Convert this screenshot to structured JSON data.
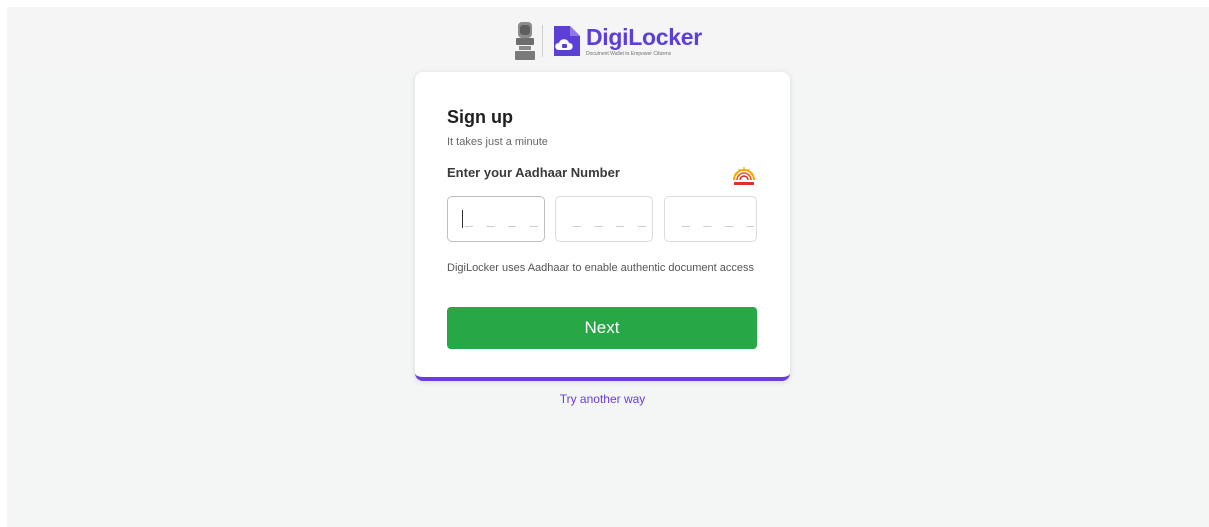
{
  "brand": {
    "name": "DigiLocker",
    "tagline": "Document Wallet to Empower Citizens",
    "accent_color": "#5b3fd6"
  },
  "form": {
    "title": "Sign up",
    "subtitle": "It takes just a minute",
    "aadhaar_label": "Enter your Aadhaar Number",
    "aadhaar_logo_text": "AADHAAR",
    "digit_fields": [
      {
        "value": "",
        "placeholder": "_ _ _ _"
      },
      {
        "value": "",
        "placeholder": "_ _ _ _"
      },
      {
        "value": "",
        "placeholder": "_ _ _ _"
      }
    ],
    "info_text": "DigiLocker uses Aadhaar to enable authentic document access",
    "next_label": "Next",
    "next_color": "#27a745",
    "card_accent_color": "#6a3ddc"
  },
  "links": {
    "try_another_way": "Try another way"
  },
  "icons": {
    "emblem": "national-emblem-icon",
    "logo": "cloud-lock-icon",
    "aadhaar": "aadhaar-logo-icon"
  }
}
